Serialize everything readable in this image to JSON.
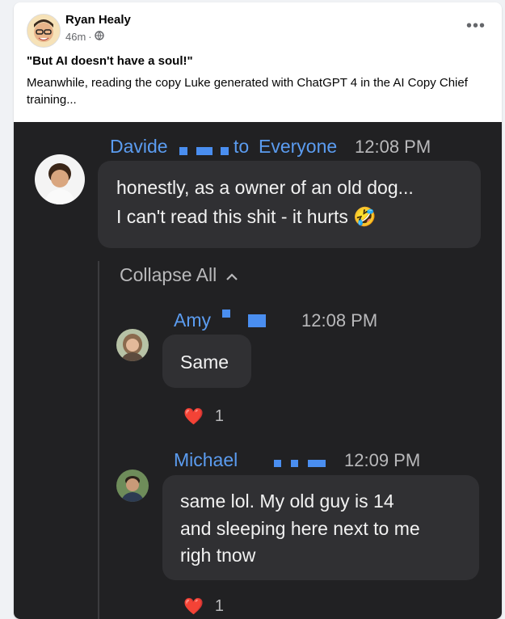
{
  "post": {
    "author": "Ryan Healy",
    "time": "46m",
    "separator": "·",
    "privacy_icon": "globe-icon",
    "more_label": "•••",
    "title": "\"But AI doesn't have a soul!\"",
    "body": "Meanwhile, reading the copy Luke generated with ChatGPT 4 in the AI Copy Chief training..."
  },
  "chat": {
    "first": {
      "sender": "Davide",
      "to": "to",
      "recipient": "Everyone",
      "time": "12:08 PM",
      "line1": "honestly, as a owner of an old dog...",
      "line2": "I can't read this shit - it hurts 🤣"
    },
    "collapse_label": "Collapse All",
    "replies": [
      {
        "sender": "Amy",
        "time": "12:08 PM",
        "text": "Same",
        "reaction": "❤️",
        "reaction_count": "1"
      },
      {
        "sender": "Michael",
        "time": "12:09 PM",
        "line1": "same lol. My old guy is 14",
        "line2": "and sleeping here next to me",
        "line3": "righ tnow",
        "reaction": "❤️",
        "reaction_count": "1"
      }
    ]
  },
  "colors": {
    "link_blue": "#5b9cf0",
    "chat_bg": "#212123",
    "bubble_bg": "#303033"
  }
}
